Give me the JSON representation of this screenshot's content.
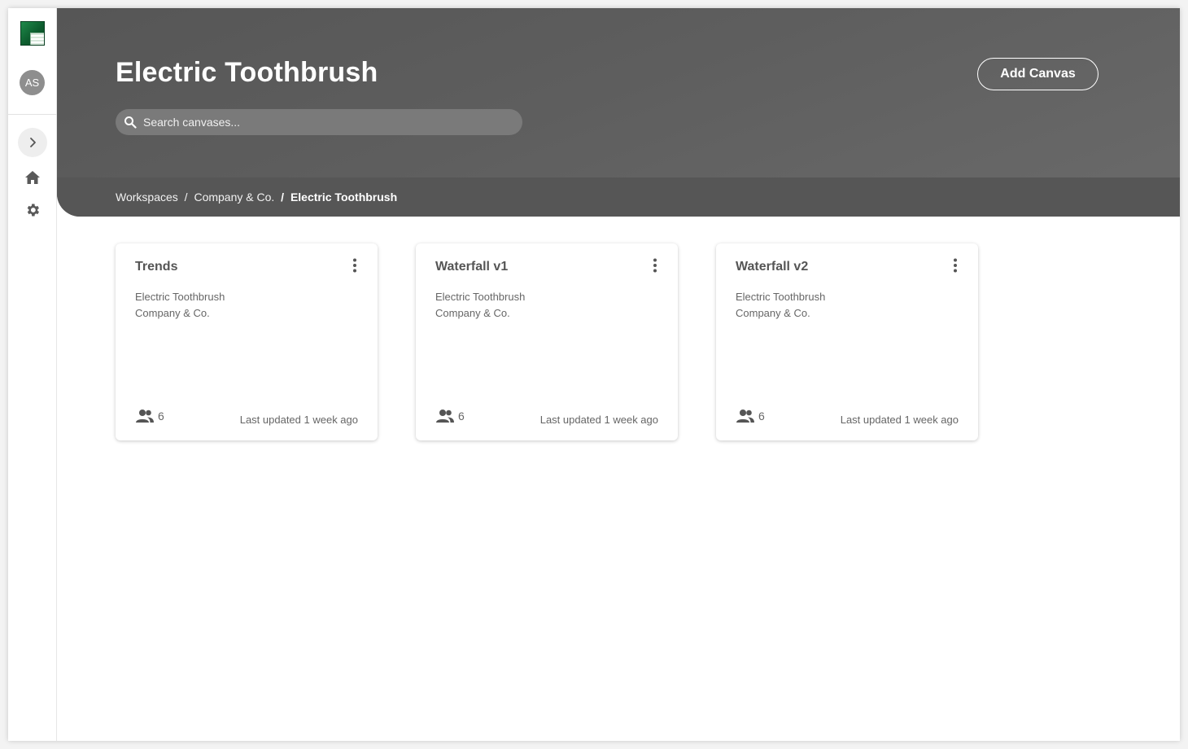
{
  "sidebar": {
    "avatar_initials": "AS",
    "expand_icon": "chevron-right-icon",
    "home_icon": "home-icon",
    "settings_icon": "gear-icon"
  },
  "header": {
    "title": "Electric Toothbrush",
    "add_button_label": "Add Canvas",
    "search_placeholder": "Search canvases...",
    "search_value": "",
    "breadcrumb": {
      "items": [
        "Workspaces",
        "Company & Co."
      ],
      "separator": "/",
      "current": "Electric Toothbrush"
    }
  },
  "cards": [
    {
      "title": "Trends",
      "line1": "Electric Toothbrush",
      "line2": "Company & Co.",
      "users": "6",
      "updated": "Last updated 1 week ago"
    },
    {
      "title": "Waterfall v1",
      "line1": "Electric Toothbrush",
      "line2": "Company & Co.",
      "users": "6",
      "updated": "Last updated 1 week ago"
    },
    {
      "title": "Waterfall v2",
      "line1": "Electric Toothbrush",
      "line2": "Company & Co.",
      "users": "6",
      "updated": "Last updated 1 week ago"
    }
  ],
  "colors": {
    "header_bg": "#5e5e5e",
    "header_band": "#565656",
    "text_muted": "#666666"
  }
}
